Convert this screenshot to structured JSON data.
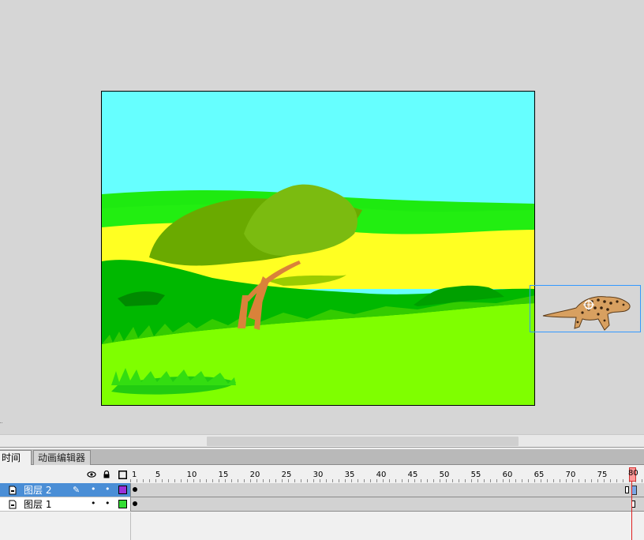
{
  "timeline": {
    "tabs": [
      {
        "label": "时间轴",
        "active": true
      },
      {
        "label": "动画编辑器",
        "active": false
      }
    ],
    "header_icons": [
      "eye-icon",
      "lock-icon",
      "outline-icon"
    ],
    "frame_ruler": [
      "1",
      "5",
      "10",
      "15",
      "20",
      "25",
      "30",
      "35",
      "40",
      "45",
      "50",
      "55",
      "60",
      "65",
      "70",
      "75",
      "80"
    ],
    "current_frame": "80",
    "layers": [
      {
        "name": "图层 2",
        "selected": true,
        "color": "#9b30d9"
      },
      {
        "name": "图层 1",
        "selected": false,
        "color": "#33dd33"
      }
    ],
    "dot": "•",
    "pencil": "✎"
  },
  "colors": {
    "sky": "#66ffff",
    "grass_dark": "#00b800",
    "grass_light": "#7fff00",
    "field_yellow": "#ffff22",
    "tree_green": "#6aaa00",
    "trunk": "#d9823a"
  }
}
